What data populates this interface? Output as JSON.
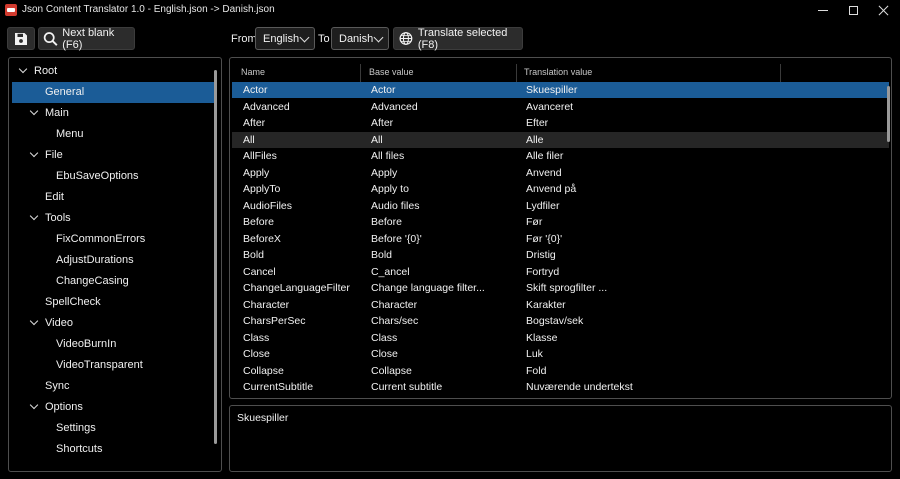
{
  "window": {
    "title": "Json Content Translator 1.0 - English.json -> Danish.json"
  },
  "toolbar": {
    "save_icon": "floppy-disk-icon",
    "next_blank_label": "Next blank (F6)",
    "from_label": "From",
    "from_value": "English",
    "to_label": "To",
    "to_value": "Danish",
    "translate_label": "Translate selected (F8)"
  },
  "tree": {
    "items": [
      {
        "label": "Root",
        "level": 0,
        "expandable": true,
        "selected": false
      },
      {
        "label": "General",
        "level": 1,
        "expandable": false,
        "selected": true
      },
      {
        "label": "Main",
        "level": 1,
        "expandable": true,
        "selected": false
      },
      {
        "label": "Menu",
        "level": 2,
        "expandable": false,
        "selected": false
      },
      {
        "label": "File",
        "level": 1,
        "expandable": true,
        "selected": false
      },
      {
        "label": "EbuSaveOptions",
        "level": 2,
        "expandable": false,
        "selected": false
      },
      {
        "label": "Edit",
        "level": 1,
        "expandable": false,
        "selected": false
      },
      {
        "label": "Tools",
        "level": 1,
        "expandable": true,
        "selected": false
      },
      {
        "label": "FixCommonErrors",
        "level": 2,
        "expandable": false,
        "selected": false
      },
      {
        "label": "AdjustDurations",
        "level": 2,
        "expandable": false,
        "selected": false
      },
      {
        "label": "ChangeCasing",
        "level": 2,
        "expandable": false,
        "selected": false
      },
      {
        "label": "SpellCheck",
        "level": 1,
        "expandable": false,
        "selected": false
      },
      {
        "label": "Video",
        "level": 1,
        "expandable": true,
        "selected": false
      },
      {
        "label": "VideoBurnIn",
        "level": 2,
        "expandable": false,
        "selected": false
      },
      {
        "label": "VideoTransparent",
        "level": 2,
        "expandable": false,
        "selected": false
      },
      {
        "label": "Sync",
        "level": 1,
        "expandable": false,
        "selected": false
      },
      {
        "label": "Options",
        "level": 1,
        "expandable": true,
        "selected": false
      },
      {
        "label": "Settings",
        "level": 2,
        "expandable": false,
        "selected": false
      },
      {
        "label": "Shortcuts",
        "level": 2,
        "expandable": false,
        "selected": false
      }
    ]
  },
  "grid": {
    "columns": [
      "Name",
      "Base value",
      "Translation value"
    ],
    "rows": [
      {
        "name": "Actor",
        "base": "Actor",
        "translation": "Skuespiller",
        "state": "selected"
      },
      {
        "name": "Advanced",
        "base": "Advanced",
        "translation": "Avanceret",
        "state": ""
      },
      {
        "name": "After",
        "base": "After",
        "translation": "Efter",
        "state": ""
      },
      {
        "name": "All",
        "base": "All",
        "translation": "Alle",
        "state": "alt"
      },
      {
        "name": "AllFiles",
        "base": "All files",
        "translation": "Alle filer",
        "state": ""
      },
      {
        "name": "Apply",
        "base": "Apply",
        "translation": "Anvend",
        "state": ""
      },
      {
        "name": "ApplyTo",
        "base": "Apply to",
        "translation": "Anvend på",
        "state": ""
      },
      {
        "name": "AudioFiles",
        "base": "Audio files",
        "translation": "Lydfiler",
        "state": ""
      },
      {
        "name": "Before",
        "base": "Before",
        "translation": "Før",
        "state": ""
      },
      {
        "name": "BeforeX",
        "base": "Before '{0}'",
        "translation": "Før '{0}'",
        "state": ""
      },
      {
        "name": "Bold",
        "base": "Bold",
        "translation": "Dristig",
        "state": ""
      },
      {
        "name": "Cancel",
        "base": "C_ancel",
        "translation": "Fortryd",
        "state": ""
      },
      {
        "name": "ChangeLanguageFilter",
        "base": "Change language filter...",
        "translation": "Skift sprogfilter ...",
        "state": ""
      },
      {
        "name": "Character",
        "base": "Character",
        "translation": "Karakter",
        "state": ""
      },
      {
        "name": "CharsPerSec",
        "base": "Chars/sec",
        "translation": "Bogstav/sek",
        "state": ""
      },
      {
        "name": "Class",
        "base": "Class",
        "translation": "Klasse",
        "state": ""
      },
      {
        "name": "Close",
        "base": "Close",
        "translation": "Luk",
        "state": ""
      },
      {
        "name": "Collapse",
        "base": "Collapse",
        "translation": "Fold",
        "state": ""
      },
      {
        "name": "CurrentSubtitle",
        "base": "Current subtitle",
        "translation": "Nuværende undertekst",
        "state": ""
      }
    ]
  },
  "editor": {
    "text": "Skuespiller"
  }
}
